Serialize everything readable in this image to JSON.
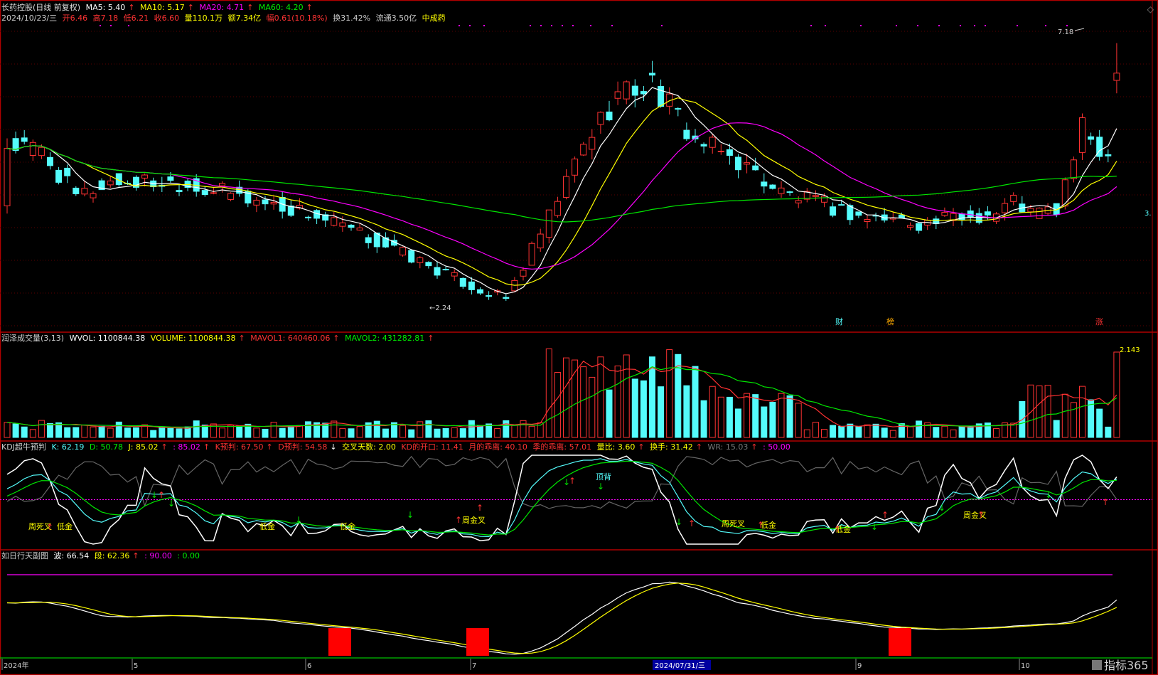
{
  "colors": {
    "up": "#ff3232",
    "down": "#54fcfc",
    "ma5": "#ffffff",
    "ma10": "#ffff00",
    "ma20": "#ff00ff",
    "ma60": "#00e600",
    "frame": "#b00000",
    "label": "#cccccc",
    "yellow": "#ffff00",
    "magenta": "#ff00ff"
  },
  "main": {
    "row1": {
      "stock": "长药控股(日线 前复权)",
      "ma5": "MA5: 5.40",
      "ma10": "MA10: 5.17",
      "ma20": "MA20: 4.71",
      "ma60": "MA60: 4.20"
    },
    "row2": {
      "date": "2024/10/23/三",
      "open": "开6.46",
      "high": "高7.18",
      "low": "低6.21",
      "close": "收6.60",
      "vol": "量110.1万",
      "amount": "额7.34亿",
      "chg": "幅0.61(10.18%)",
      "turnover": "换31.42%",
      "float": "流通3.50亿",
      "sector": "中成药"
    },
    "high_label": "7.18",
    "low_label": "←2.24",
    "right_label": "3.",
    "markers": [
      "财",
      "榜",
      "涨"
    ]
  },
  "vol_panel": {
    "name": "润泽成交量(3,13)",
    "wvol": "WVOL: 1100844.38",
    "volume": "VOLUME: 1100844.38",
    "mavol1": "MAVOL1: 640460.06",
    "mavol2": "MAVOL2: 431282.81",
    "scale": "2.143"
  },
  "kdj_panel": {
    "name": "KDJ超牛预判",
    "k": "K: 62.19",
    "d": "D: 50.78",
    "j": "J: 85.02",
    "j2": ": 85.02",
    "kpre": "K预判: 67.50",
    "dpre": "D预判: 54.58",
    "cross": "交叉天数: 2.00",
    "open": "KD的开口: 11.41",
    "month": "月的乖离: 40.10",
    "season": "季的乖离: 57.01",
    "ratio": "量比: 3.60",
    "turn": "换手: 31.42",
    "wr": "WR: 15.03",
    "fifty": ": 50.00",
    "labels": [
      "周死叉",
      "低金",
      "低金",
      "低金",
      "周金叉",
      "顶背",
      "周死叉",
      "低金",
      "低金",
      "周金叉"
    ]
  },
  "rx_panel": {
    "name": "如日行天副图",
    "bo": "波: 66.54",
    "duan": "段: 62.36",
    "v90": ": 90.00",
    "v0": ": 0.00"
  },
  "axis": {
    "labels": [
      "2024年",
      "5",
      "6",
      "7",
      "2024/07/31/三",
      "9",
      "10"
    ]
  },
  "watermark": "指标365",
  "controls": [
    "expand-icon",
    "collapse-icon"
  ]
}
